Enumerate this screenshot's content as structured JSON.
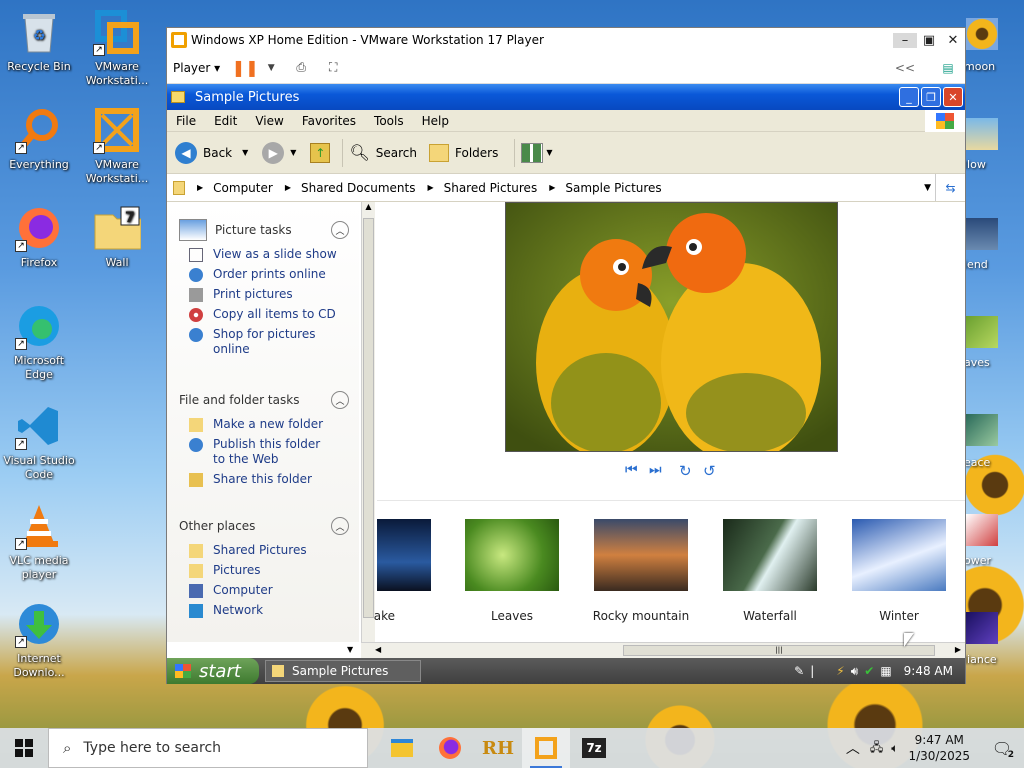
{
  "desktop": {
    "icons": [
      {
        "label": "Recycle Bin"
      },
      {
        "label": "VMware Workstati..."
      },
      {
        "label": "Everything"
      },
      {
        "label": "VMware Workstati..."
      },
      {
        "label": "Firefox"
      },
      {
        "label": "Wall"
      },
      {
        "label": "Microsoft Edge"
      },
      {
        "label": "Visual Studio Code"
      },
      {
        "label": "VLC media player"
      },
      {
        "label": "Internet Downlo..."
      }
    ],
    "right_labels": [
      "moon",
      "llow",
      "iend",
      "aves",
      "eace",
      "ower",
      "liance"
    ]
  },
  "vmware": {
    "title": "Windows XP Home Edition - VMware Workstation 17 Player",
    "player_menu": "Player",
    "collapse": "<<"
  },
  "xp_window": {
    "title": "Sample Pictures",
    "menu": [
      "File",
      "Edit",
      "View",
      "Favorites",
      "Tools",
      "Help"
    ],
    "toolbar": {
      "back": "Back",
      "search": "Search",
      "folders": "Folders"
    },
    "address": [
      "Computer",
      "Shared Documents",
      "Shared Pictures",
      "Sample Pictures"
    ],
    "tasks": {
      "picture": {
        "title": "Picture tasks",
        "items": [
          "View as a slide show",
          "Order prints online",
          "Print pictures",
          "Copy all items to CD",
          "Shop for pictures online"
        ]
      },
      "file": {
        "title": "File and folder tasks",
        "items": [
          "Make a new folder",
          "Publish this folder to the Web",
          "Share this folder"
        ]
      },
      "other": {
        "title": "Other places",
        "items": [
          "Shared Pictures",
          "Pictures",
          "Computer",
          "Network"
        ]
      }
    },
    "thumbnails": [
      "ake",
      "Leaves",
      "Rocky mountain",
      "Waterfall",
      "Winter"
    ]
  },
  "xp_taskbar": {
    "start": "start",
    "task": "Sample Pictures",
    "time": "9:48 AM"
  },
  "win10": {
    "search_placeholder": "Type here to search",
    "time": "9:47 AM",
    "date": "1/30/2025",
    "notifications": "2"
  }
}
